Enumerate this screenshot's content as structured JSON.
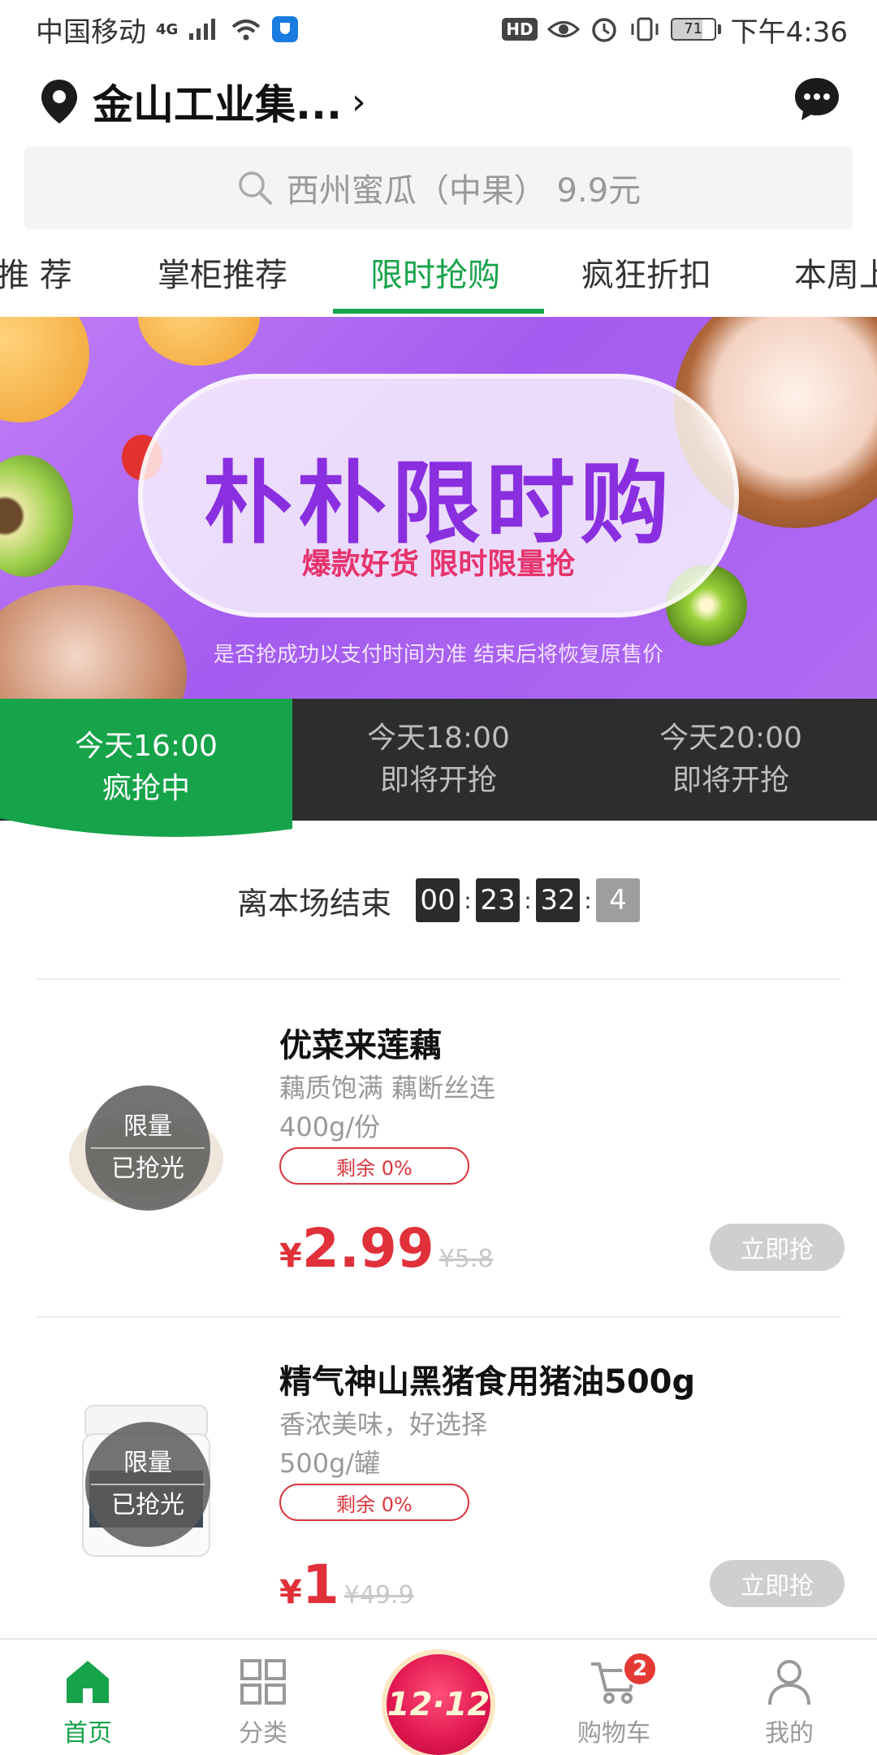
{
  "status_bar": {
    "carrier": "中国移动",
    "network": "4G",
    "battery": "71",
    "time": "下午4:36"
  },
  "header": {
    "location": "金山工业集...",
    "icons": {
      "location": "location-pin-icon",
      "message": "message-bubble-icon"
    }
  },
  "search": {
    "placeholder": "西州蜜瓜（中果） 9.9元"
  },
  "tabs": [
    {
      "label": "推 荐"
    },
    {
      "label": "掌柜推荐"
    },
    {
      "label": "限时抢购",
      "active": true
    },
    {
      "label": "疯狂折扣"
    },
    {
      "label": "本周上新"
    }
  ],
  "banner": {
    "title": "朴朴限时购",
    "subtitle": "爆款好货 限时限量抢",
    "notice": "是否抢成功以支付时间为准 结束后将恢复原售价"
  },
  "sessions": [
    {
      "time": "今天16:00",
      "status": "疯抢中",
      "active": true
    },
    {
      "time": "今天18:00",
      "status": "即将开抢"
    },
    {
      "time": "今天20:00",
      "status": "即将开抢"
    }
  ],
  "countdown": {
    "label": "离本场结束",
    "hours": "00",
    "minutes": "23",
    "seconds": "32",
    "tenths": "4"
  },
  "products": [
    {
      "name": "优菜来莲藕",
      "desc": "藕质饱满 藕断丝连",
      "spec": "400g/份",
      "stock": "剩余 0%",
      "currency": "¥",
      "price": "2.99",
      "original_price": "¥5.8",
      "overlay_top": "限量",
      "overlay_bottom": "已抢光",
      "button": "立即抢"
    },
    {
      "name": "精气神山黑猪食用猪油500g",
      "desc": "香浓美味，好选择",
      "spec": "500g/罐",
      "stock": "剩余 0%",
      "currency": "¥",
      "price": "1",
      "original_price": "¥49.9",
      "overlay_top": "限量",
      "overlay_bottom": "已抢光",
      "button": "立即抢"
    }
  ],
  "bottom_nav": {
    "home": "首页",
    "category": "分类",
    "promo": "12·12",
    "cart": "购物车",
    "cart_count": "2",
    "mine": "我的"
  },
  "colors": {
    "brand_green": "#16a34a",
    "price_red": "#e0303a",
    "banner_purple": "#a45cf0"
  }
}
